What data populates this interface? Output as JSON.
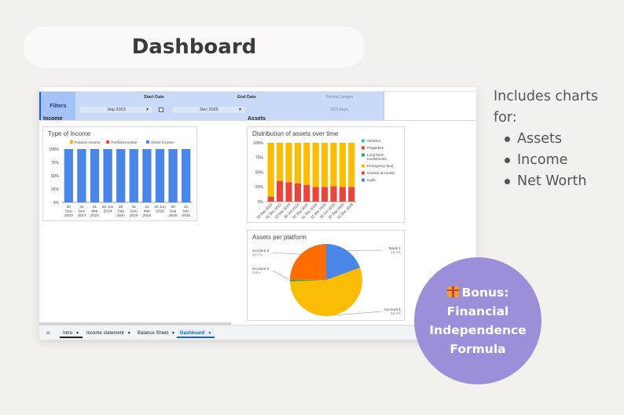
{
  "header": {
    "title": "Dashboard"
  },
  "filters": {
    "label": "Filters",
    "start_label": "Start Date",
    "start_value": "Sep 2023",
    "end_label": "End Date",
    "end_value": "Dec 2025",
    "period_label": "Period Lenght",
    "period_value": "823 days"
  },
  "sections": {
    "income": "Income",
    "assets": "Assets"
  },
  "includes": {
    "heading_line1": "Includes charts",
    "heading_line2": "for:",
    "items": [
      "Assets",
      "Income",
      "Net Worth"
    ]
  },
  "bonus": {
    "line1": "Bonus:",
    "line2": "Financial",
    "line3": "Independence",
    "line4": "Formula",
    "icon": "gift-icon"
  },
  "tabs": [
    {
      "label": "Intro"
    },
    {
      "label": "Income statement"
    },
    {
      "label": "Balance Sheet"
    },
    {
      "label": "Dashboard",
      "active": true
    }
  ],
  "chart_data": [
    {
      "type": "bar",
      "stacked": true,
      "title": "Type of income",
      "legend": [
        "Passive Income",
        "Portfolio income",
        "Active Income"
      ],
      "legend_position": "top",
      "colors": [
        "#f5b800",
        "#e8453c",
        "#4a86e8"
      ],
      "categories": [
        [
          "30",
          "Sep",
          "2023"
        ],
        [
          "31",
          "Dec",
          "2023"
        ],
        [
          "31",
          "Mar",
          "2024"
        ],
        [
          "30 Jun",
          "2024"
        ],
        [
          "30",
          "Sep",
          "2024"
        ],
        [
          "31",
          "Dec",
          "2024"
        ],
        [
          "31",
          "Mar",
          "2025"
        ],
        [
          "30 Jun",
          "2025"
        ],
        [
          "30",
          "Sep",
          "2025"
        ],
        [
          "31",
          "Dec",
          "2025"
        ]
      ],
      "series": [
        {
          "name": "Passive Income",
          "values": [
            0,
            0,
            0,
            0,
            0,
            0,
            0,
            0,
            0,
            0
          ]
        },
        {
          "name": "Portfolio income",
          "values": [
            0,
            0,
            0,
            0,
            0,
            0,
            0,
            0,
            0,
            0
          ]
        },
        {
          "name": "Active Income",
          "values": [
            100,
            100,
            100,
            100,
            100,
            100,
            100,
            100,
            100,
            100
          ]
        }
      ],
      "y_ticks": [
        "100%",
        "75%",
        "50%",
        "25%",
        "0%"
      ],
      "ylim": [
        0,
        100
      ]
    },
    {
      "type": "bar",
      "stacked": true,
      "title": "Distribution of assets over time",
      "legend": [
        "Vehicles",
        "Properties",
        "Long Term Investments",
        "Emergency fund",
        "Current accounts",
        "Cash"
      ],
      "legend_position": "right",
      "colors": [
        "#46bdc6",
        "#ea4335",
        "#34a853",
        "#fbbc04",
        "#e8453c",
        "#4285f4"
      ],
      "categories": [
        "30 Sep 2023",
        "31 Dec 2023",
        "31 Mar 2024",
        "30 Jun 2024",
        "30 Sep 2024",
        "31 Dec 2024",
        "31 Mar 2025",
        "30 Jun 2025",
        "30 Sep 2025",
        "31 Dec 2025"
      ],
      "series": [
        {
          "name": "Current accounts",
          "values": [
            8,
            35,
            33,
            31,
            28,
            25,
            25,
            26,
            25,
            25
          ]
        },
        {
          "name": "Emergency fund",
          "values": [
            92,
            65,
            67,
            69,
            72,
            75,
            75,
            74,
            75,
            75
          ]
        }
      ],
      "y_ticks": [
        "100%",
        "75%",
        "50%",
        "25%",
        "0%"
      ],
      "ylim": [
        0,
        100
      ]
    },
    {
      "type": "pie",
      "title": "Assets per platform",
      "colors": [
        "#4a86e8",
        "#fbbc04",
        "#34a853",
        "#ff6d01"
      ],
      "slices": [
        {
          "name": "Bank 1",
          "pct_label": "19.4%",
          "value": 19.4
        },
        {
          "name": "Account 1",
          "pct_label": "55.0%",
          "value": 55.0
        },
        {
          "name": "Account 2",
          "pct_label": "0.8%",
          "value": 0.8
        },
        {
          "name": "Account 3",
          "pct_label": "20.7%",
          "value": 24.8
        }
      ]
    }
  ]
}
